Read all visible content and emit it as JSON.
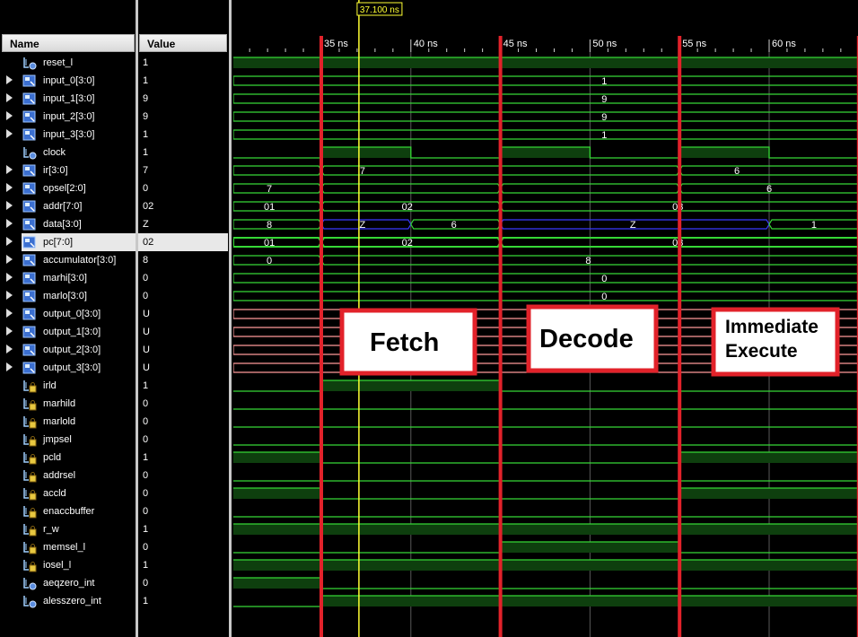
{
  "header": {
    "name_col": "Name",
    "value_col": "Value"
  },
  "cursor_label": "37.100 ns",
  "time_ticks": [
    {
      "label": "35 ns",
      "t": 35
    },
    {
      "label": "40 ns",
      "t": 40
    },
    {
      "label": "45 ns",
      "t": 45
    },
    {
      "label": "50 ns",
      "t": 50
    },
    {
      "label": "55 ns",
      "t": 55
    },
    {
      "label": "60 ns",
      "t": 60
    }
  ],
  "signals": [
    {
      "name": "reset_l",
      "value": "1",
      "bus": false,
      "icon": "bit-signal-icon"
    },
    {
      "name": "input_0[3:0]",
      "value": "1",
      "bus": true,
      "icon": "bus-signal-icon"
    },
    {
      "name": "input_1[3:0]",
      "value": "9",
      "bus": true,
      "icon": "bus-signal-icon"
    },
    {
      "name": "input_2[3:0]",
      "value": "9",
      "bus": true,
      "icon": "bus-signal-icon"
    },
    {
      "name": "input_3[3:0]",
      "value": "1",
      "bus": true,
      "icon": "bus-signal-icon"
    },
    {
      "name": "clock",
      "value": "1",
      "bus": false,
      "icon": "bit-signal-icon"
    },
    {
      "name": "ir[3:0]",
      "value": "7",
      "bus": true,
      "icon": "bus-signal-icon"
    },
    {
      "name": "opsel[2:0]",
      "value": "0",
      "bus": true,
      "icon": "bus-signal-icon"
    },
    {
      "name": "addr[7:0]",
      "value": "02",
      "bus": true,
      "icon": "bus-signal-icon"
    },
    {
      "name": "data[3:0]",
      "value": "Z",
      "bus": true,
      "icon": "bus-signal-icon"
    },
    {
      "name": "pc[7:0]",
      "value": "02",
      "bus": true,
      "icon": "bus-signal-icon",
      "selected": true
    },
    {
      "name": "accumulator[3:0]",
      "value": "8",
      "bus": true,
      "icon": "bus-signal-icon"
    },
    {
      "name": "marhi[3:0]",
      "value": "0",
      "bus": true,
      "icon": "bus-signal-icon"
    },
    {
      "name": "marlo[3:0]",
      "value": "0",
      "bus": true,
      "icon": "bus-signal-icon"
    },
    {
      "name": "output_0[3:0]",
      "value": "U",
      "bus": true,
      "icon": "bus-signal-icon"
    },
    {
      "name": "output_1[3:0]",
      "value": "U",
      "bus": true,
      "icon": "bus-signal-icon"
    },
    {
      "name": "output_2[3:0]",
      "value": "U",
      "bus": true,
      "icon": "bus-signal-icon"
    },
    {
      "name": "output_3[3:0]",
      "value": "U",
      "bus": true,
      "icon": "bus-signal-icon"
    },
    {
      "name": "irld",
      "value": "1",
      "bus": false,
      "icon": "bit-signal-lock-icon"
    },
    {
      "name": "marhild",
      "value": "0",
      "bus": false,
      "icon": "bit-signal-lock-icon"
    },
    {
      "name": "marlold",
      "value": "0",
      "bus": false,
      "icon": "bit-signal-lock-icon"
    },
    {
      "name": "jmpsel",
      "value": "0",
      "bus": false,
      "icon": "bit-signal-lock-icon"
    },
    {
      "name": "pcld",
      "value": "1",
      "bus": false,
      "icon": "bit-signal-lock-icon"
    },
    {
      "name": "addrsel",
      "value": "0",
      "bus": false,
      "icon": "bit-signal-lock-icon"
    },
    {
      "name": "accld",
      "value": "0",
      "bus": false,
      "icon": "bit-signal-lock-icon"
    },
    {
      "name": "enaccbuffer",
      "value": "0",
      "bus": false,
      "icon": "bit-signal-lock-icon"
    },
    {
      "name": "r_w",
      "value": "1",
      "bus": false,
      "icon": "bit-signal-lock-icon"
    },
    {
      "name": "memsel_l",
      "value": "0",
      "bus": false,
      "icon": "bit-signal-lock-icon"
    },
    {
      "name": "iosel_l",
      "value": "1",
      "bus": false,
      "icon": "bit-signal-lock-icon"
    },
    {
      "name": "aeqzero_int",
      "value": "0",
      "bus": false,
      "icon": "bit-signal-icon"
    },
    {
      "name": "alesszero_int",
      "value": "1",
      "bus": false,
      "icon": "bit-signal-icon"
    }
  ],
  "waves": [
    {
      "kind": "bit",
      "segs": [
        [
          30,
          65,
          1
        ]
      ]
    },
    {
      "kind": "bus",
      "segs": [
        [
          30,
          65,
          "1"
        ]
      ],
      "labelT": 50.8
    },
    {
      "kind": "bus",
      "segs": [
        [
          30,
          65,
          "9"
        ]
      ],
      "labelT": 50.8
    },
    {
      "kind": "bus",
      "segs": [
        [
          30,
          65,
          "9"
        ]
      ],
      "labelT": 50.8
    },
    {
      "kind": "bus",
      "segs": [
        [
          30,
          65,
          "1"
        ]
      ],
      "labelT": 50.8
    },
    {
      "kind": "bit",
      "segs": [
        [
          30,
          35,
          0
        ],
        [
          35,
          40,
          1
        ],
        [
          40,
          45,
          0
        ],
        [
          45,
          50,
          1
        ],
        [
          50,
          55,
          0
        ],
        [
          55,
          60,
          1
        ],
        [
          60,
          65,
          0
        ]
      ]
    },
    {
      "kind": "bus",
      "segs": [
        [
          30,
          35,
          ""
        ],
        [
          35,
          55,
          "7"
        ],
        [
          55,
          65,
          "6"
        ]
      ],
      "labelTs": [
        null,
        37.3,
        58.2
      ]
    },
    {
      "kind": "bus",
      "segs": [
        [
          30,
          35,
          "7"
        ],
        [
          35,
          45,
          ""
        ],
        [
          45,
          55,
          ""
        ],
        [
          55,
          65,
          "6"
        ]
      ],
      "labelTs": [
        32.1,
        null,
        null,
        60
      ]
    },
    {
      "kind": "bus",
      "segs": [
        [
          30,
          35,
          "01"
        ],
        [
          35,
          45,
          "02"
        ],
        [
          45,
          65,
          "03"
        ]
      ],
      "labelTs": [
        32.1,
        39.8,
        54.9
      ]
    },
    {
      "kind": "bus",
      "segs": [
        [
          30,
          35,
          "8"
        ],
        [
          35,
          40,
          "Z",
          "z"
        ],
        [
          40,
          45,
          "6"
        ],
        [
          45,
          60,
          "Z",
          "z"
        ],
        [
          60,
          65,
          "1"
        ]
      ],
      "labelTs": [
        32.1,
        37.3,
        42.4,
        52.4,
        62.5
      ]
    },
    {
      "kind": "bus",
      "segs": [
        [
          30,
          35,
          "01"
        ],
        [
          35,
          45,
          "02"
        ],
        [
          45,
          65,
          "03"
        ]
      ],
      "labelTs": [
        32.1,
        39.8,
        54.9
      ],
      "selected": true
    },
    {
      "kind": "bus",
      "segs": [
        [
          30,
          35,
          "0"
        ],
        [
          35,
          65,
          "8"
        ]
      ],
      "labelTs": [
        32.1,
        49.9
      ]
    },
    {
      "kind": "bus",
      "segs": [
        [
          30,
          65,
          "0"
        ]
      ],
      "labelT": 50.8
    },
    {
      "kind": "bus",
      "segs": [
        [
          30,
          65,
          "0"
        ]
      ],
      "labelT": 50.8
    },
    {
      "kind": "bus",
      "segs": [
        [
          30,
          65,
          ""
        ]
      ],
      "color": "u"
    },
    {
      "kind": "bus",
      "segs": [
        [
          30,
          65,
          ""
        ]
      ],
      "color": "u"
    },
    {
      "kind": "bus",
      "segs": [
        [
          30,
          65,
          ""
        ]
      ],
      "color": "u"
    },
    {
      "kind": "bus",
      "segs": [
        [
          30,
          65,
          ""
        ]
      ],
      "color": "u"
    },
    {
      "kind": "bit",
      "segs": [
        [
          30,
          35,
          0
        ],
        [
          35,
          45,
          1
        ],
        [
          45,
          65,
          0
        ]
      ]
    },
    {
      "kind": "bit",
      "segs": [
        [
          30,
          65,
          0
        ]
      ]
    },
    {
      "kind": "bit",
      "segs": [
        [
          30,
          65,
          0
        ]
      ]
    },
    {
      "kind": "bit",
      "segs": [
        [
          30,
          65,
          0
        ]
      ]
    },
    {
      "kind": "bit",
      "segs": [
        [
          30,
          35,
          1
        ],
        [
          35,
          45,
          0
        ],
        [
          45,
          55,
          0
        ],
        [
          55,
          65,
          1
        ]
      ]
    },
    {
      "kind": "bit",
      "segs": [
        [
          30,
          65,
          0
        ]
      ]
    },
    {
      "kind": "bit",
      "segs": [
        [
          30,
          35,
          1
        ],
        [
          35,
          55,
          0
        ],
        [
          55,
          65,
          1
        ]
      ]
    },
    {
      "kind": "bit",
      "segs": [
        [
          30,
          65,
          0
        ]
      ]
    },
    {
      "kind": "bit",
      "segs": [
        [
          30,
          65,
          1
        ]
      ]
    },
    {
      "kind": "bit",
      "segs": [
        [
          30,
          45,
          0
        ],
        [
          45,
          55,
          1
        ],
        [
          55,
          65,
          0
        ]
      ]
    },
    {
      "kind": "bit",
      "segs": [
        [
          30,
          65,
          1
        ]
      ]
    },
    {
      "kind": "bit",
      "segs": [
        [
          30,
          35,
          1
        ],
        [
          35,
          65,
          0
        ]
      ]
    },
    {
      "kind": "bit",
      "segs": [
        [
          30,
          35,
          0
        ],
        [
          35,
          65,
          1
        ]
      ]
    }
  ],
  "cursor_time": 37.1,
  "markers": [
    35,
    45,
    55,
    65
  ],
  "annotations": [
    {
      "text": "Fetch",
      "lines": [
        "Fetch"
      ]
    },
    {
      "text": "Decode",
      "lines": [
        "Decode"
      ]
    },
    {
      "text": "Immediate Execute",
      "lines": [
        "Immediate",
        "Execute"
      ]
    }
  ],
  "colors": {
    "wave": "#36d836",
    "wave_fill": "#0e3f0e",
    "z": "#3a3aff",
    "u": "#ff9a9a",
    "cursor": "#ffff33",
    "marker": "#e2222a",
    "grid": "#5a5a5a"
  }
}
